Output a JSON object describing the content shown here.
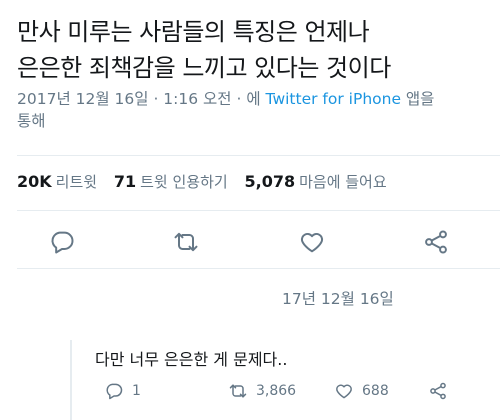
{
  "tweet": {
    "text_line1": "만사 미루는 사람들의 특징은 언제나",
    "text_line2": "은은한 죄책감을 느끼고 있다는 것이다",
    "timestamp": "2017년 12월 16일 · 1:16 오전 · 에",
    "client": "Twitter for iPhone",
    "client_suffix_1": "앱을",
    "client_suffix_2": "통해"
  },
  "stats": {
    "retweets_count": "20K",
    "retweets_label": "리트윗",
    "quotes_count": "71",
    "quotes_label": "트윗 인용하기",
    "likes_count": "5,078",
    "likes_label": "마음에 들어요"
  },
  "actions": {
    "icons": [
      "reply-icon",
      "retweet-icon",
      "like-icon",
      "share-icon"
    ]
  },
  "reply": {
    "date": "17년 12월 16일",
    "text": "다만 너무 은은한 게 문제다..",
    "reply_count": "1",
    "retweet_count": "3,866",
    "like_count": "688"
  },
  "colors": {
    "text": "#14171a",
    "secondary": "#657786",
    "link": "#1b95e0",
    "divider": "#e6ecf0"
  }
}
